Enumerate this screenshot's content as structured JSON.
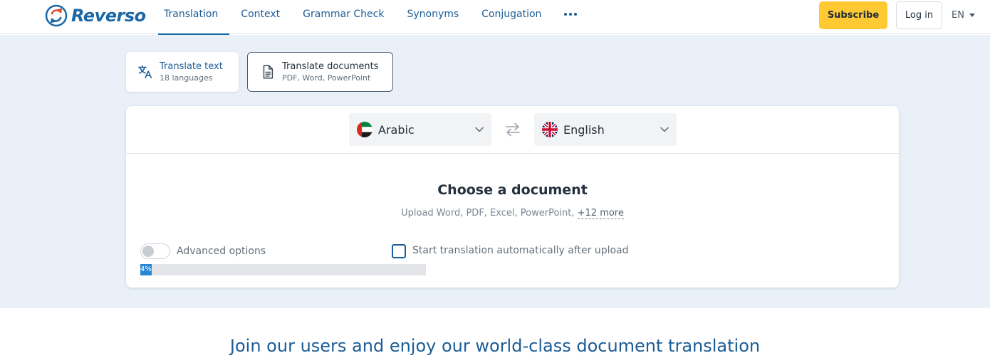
{
  "header": {
    "logo_text": "Reverso",
    "nav": [
      "Translation",
      "Context",
      "Grammar Check",
      "Synonyms",
      "Conjugation"
    ],
    "active_nav": "Translation",
    "subscribe_label": "Subscribe",
    "login_label": "Log in",
    "ui_language": "EN"
  },
  "modes": {
    "text": {
      "title": "Translate text",
      "subtitle": "18 languages"
    },
    "documents": {
      "title": "Translate documents",
      "subtitle": "PDF, Word, PowerPoint"
    }
  },
  "translator": {
    "source_language": "Arabic",
    "target_language": "English",
    "source_flag": "uae-flag-icon",
    "target_flag": "uk-flag-icon"
  },
  "upload": {
    "title": "Choose a document",
    "subtitle": "Upload Word, PDF, Excel, PowerPoint,",
    "more_link": "+12 more",
    "advanced_label": "Advanced options",
    "auto_start_label": "Start translation automatically after upload",
    "advanced_enabled": false,
    "auto_start_checked": false,
    "progress_percent": 4,
    "progress_text": "4%"
  },
  "promo": {
    "headline": "Join our users and enjoy our world-class document translation"
  },
  "colors": {
    "brand_blue": "#1a67a6",
    "subscribe_yellow": "#ffc933",
    "hero_background": "#e9f0f8",
    "progress_blue": "#2a86d1"
  }
}
